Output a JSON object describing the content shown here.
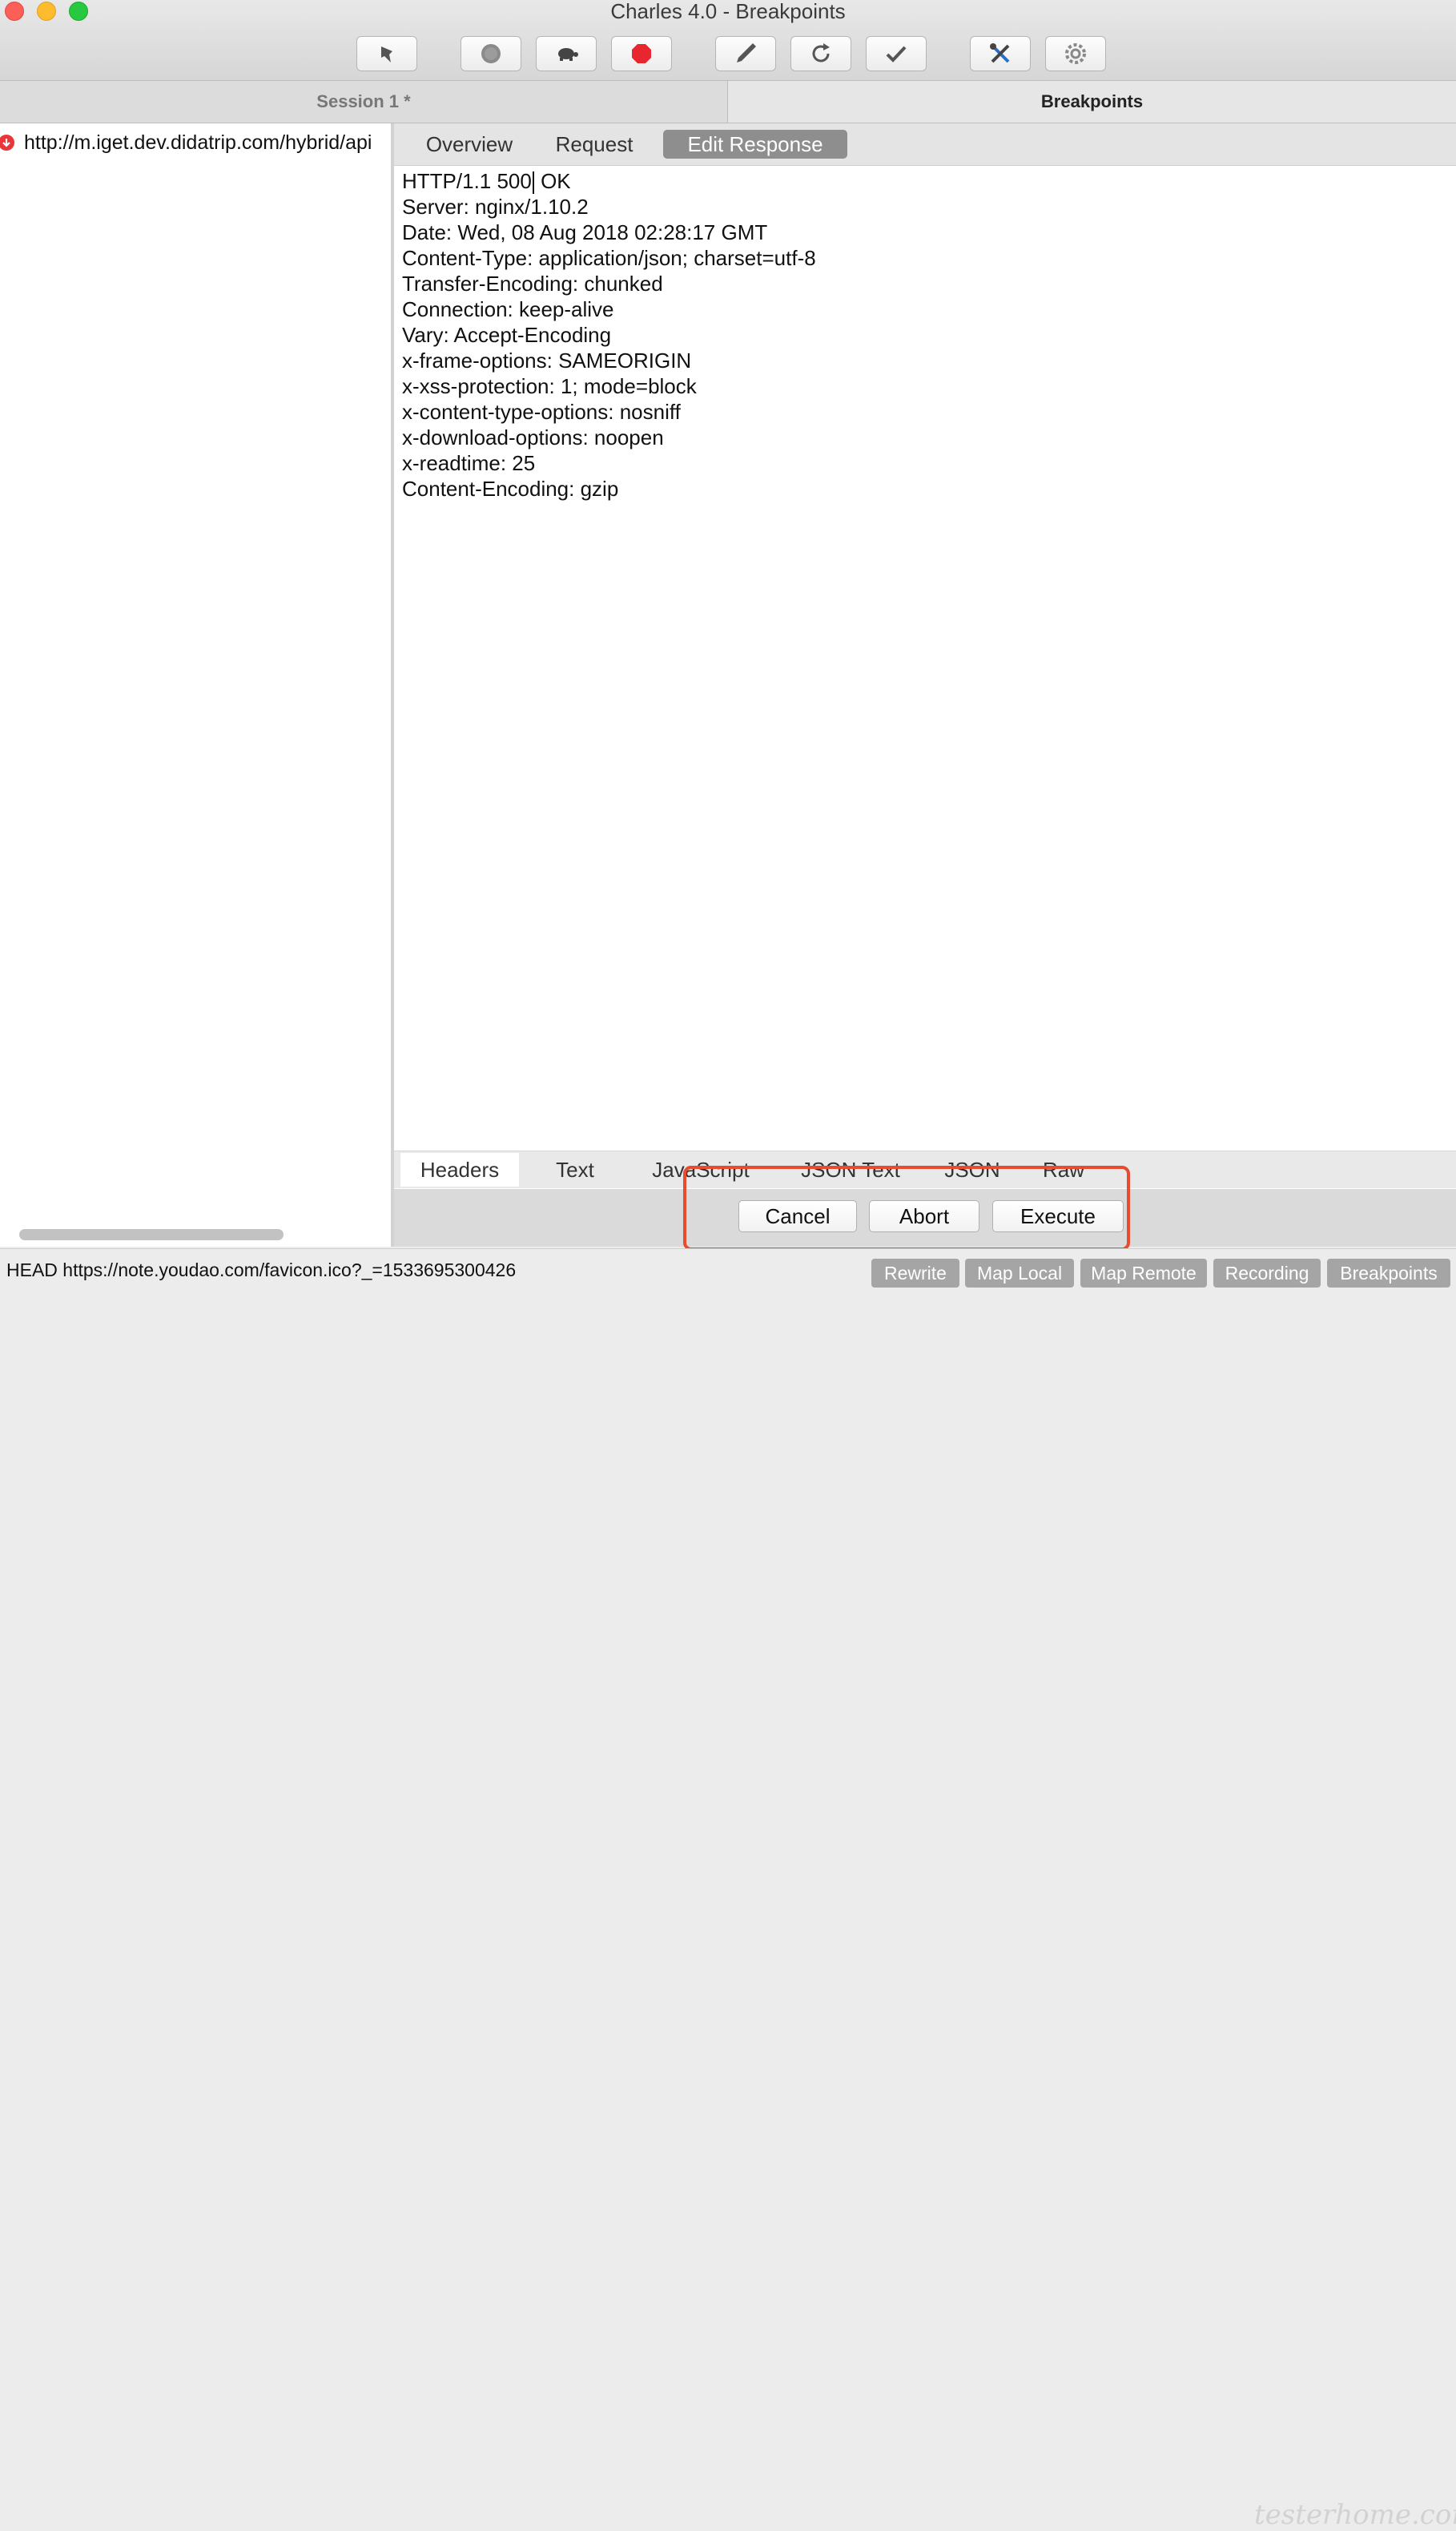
{
  "window": {
    "title": "Charles 4.0 - Breakpoints"
  },
  "toolbar": {
    "buttons": [
      {
        "name": "broom-icon"
      },
      {
        "name": "record-icon"
      },
      {
        "name": "turtle-icon"
      },
      {
        "name": "stop-icon",
        "color": "#e8262f"
      },
      {
        "name": "pen-icon"
      },
      {
        "name": "refresh-icon"
      },
      {
        "name": "checkmark-icon"
      },
      {
        "name": "tools-icon"
      },
      {
        "name": "gear-icon"
      }
    ]
  },
  "tabs": {
    "session": "Session 1 *",
    "breakpoints": "Breakpoints"
  },
  "tree": {
    "item_url": "http://m.iget.dev.didatrip.com/hybrid/api"
  },
  "subtabs": {
    "overview": "Overview",
    "request": "Request",
    "edit_response": "Edit Response"
  },
  "editor": {
    "status_line_prefix": "HTTP/1.1 500",
    "status_line_suffix": " OK",
    "headers": [
      "Server: nginx/1.10.2",
      "Date: Wed, 08 Aug 2018 02:28:17 GMT",
      "Content-Type: application/json; charset=utf-8",
      "Transfer-Encoding: chunked",
      "Connection: keep-alive",
      "Vary: Accept-Encoding",
      "x-frame-options: SAMEORIGIN",
      "x-xss-protection: 1; mode=block",
      "x-content-type-options: nosniff",
      "x-download-options: noopen",
      "x-readtime: 25",
      "Content-Encoding: gzip"
    ]
  },
  "format_tabs": {
    "headers": "Headers",
    "text": "Text",
    "javascript": "JavaScript",
    "json_text": "JSON Text",
    "json": "JSON",
    "raw": "Raw"
  },
  "actions": {
    "cancel": "Cancel",
    "abort": "Abort",
    "execute": "Execute"
  },
  "status": {
    "text": "HEAD https://note.youdao.com/favicon.ico?_=1533695300426",
    "buttons": {
      "rewrite": "Rewrite",
      "map_local": "Map Local",
      "map_remote": "Map Remote",
      "recording": "Recording",
      "breakpoints": "Breakpoints"
    },
    "watermark": "testerhome.com"
  },
  "colors": {
    "highlight": "#e84b2e",
    "breakpoint": "#e8363a",
    "active_tab": "#8e8e8e"
  }
}
